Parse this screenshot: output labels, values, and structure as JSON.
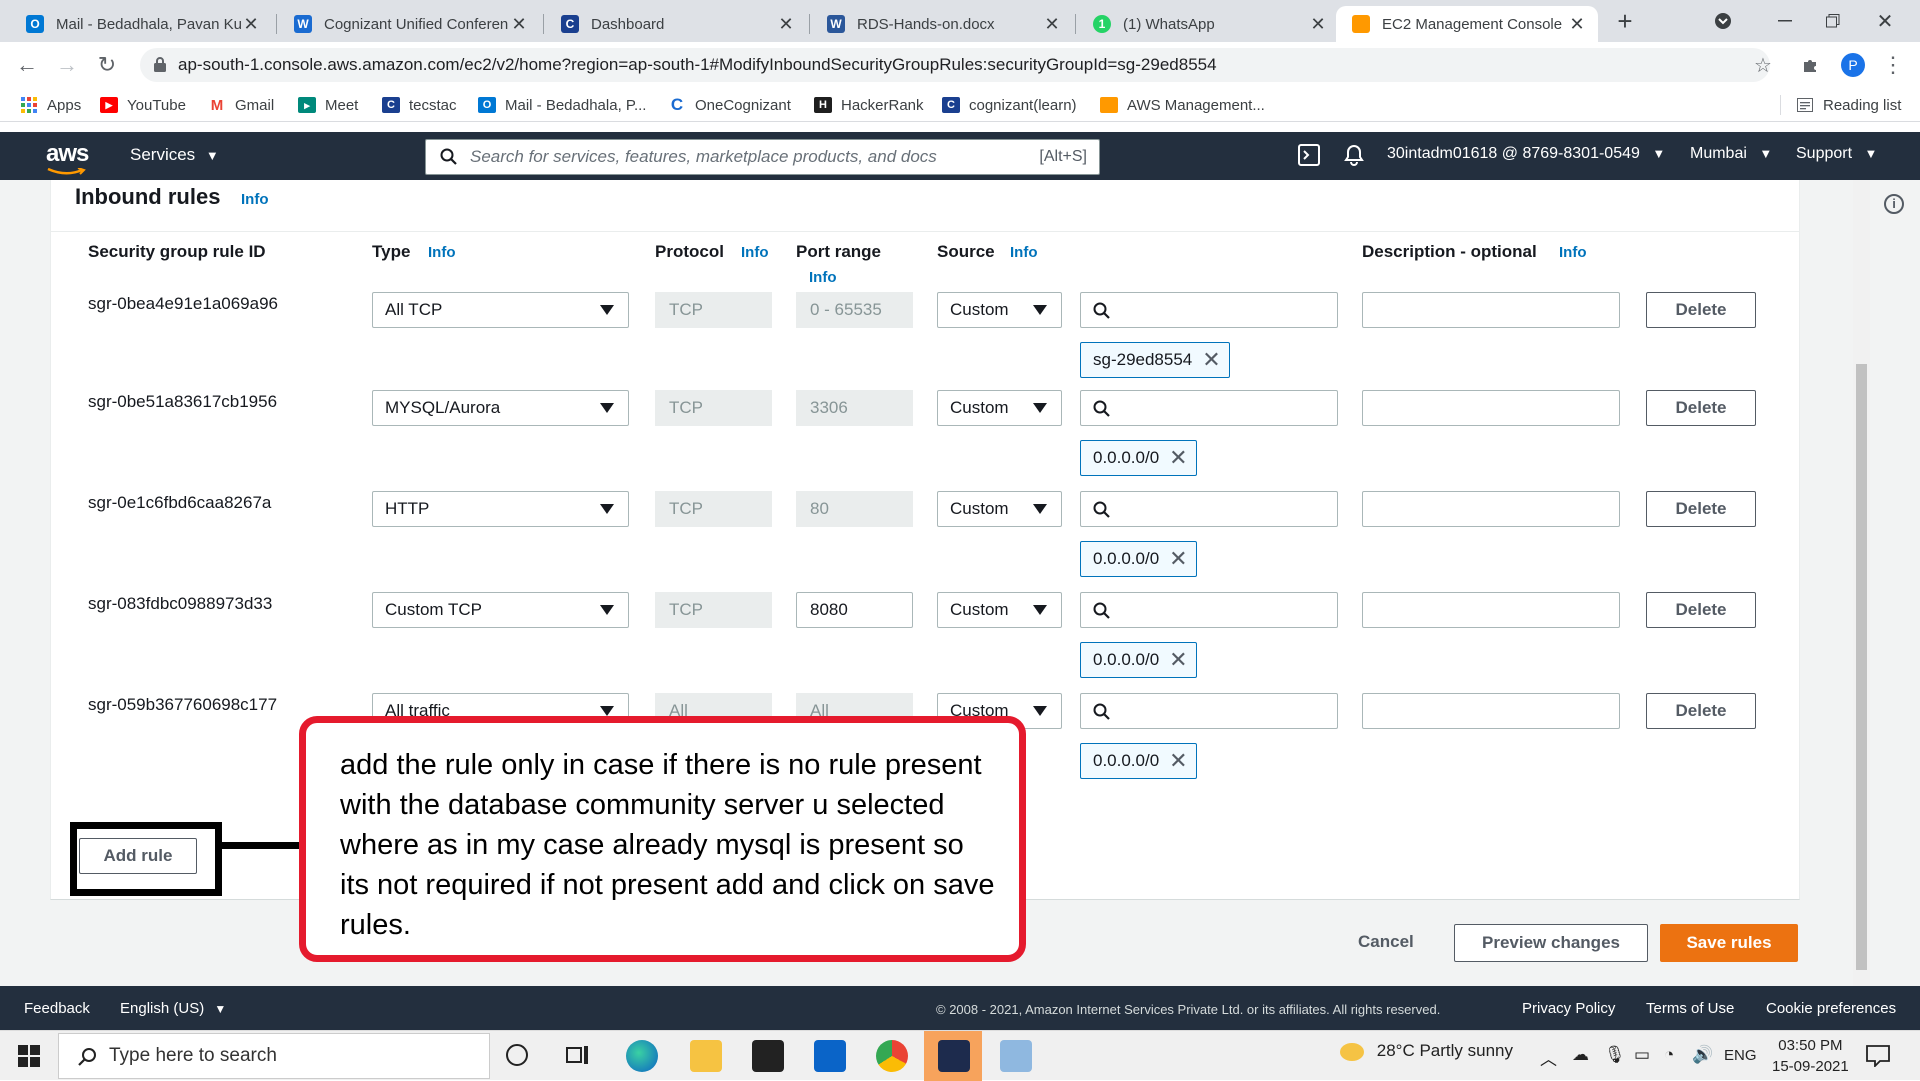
{
  "browser": {
    "tabs": [
      {
        "title": "Mail - Bedadhala, Pavan Ku",
        "color": "#0078d4",
        "glyph": "O"
      },
      {
        "title": "Cognizant Unified Conferen",
        "color": "#1a6bd1",
        "glyph": "W"
      },
      {
        "title": "Dashboard",
        "color": "#1a3f8f",
        "glyph": "C"
      },
      {
        "title": "RDS-Hands-on.docx",
        "color": "#2b579a",
        "glyph": "W"
      },
      {
        "title": "(1) WhatsApp",
        "color": "#25d366",
        "glyph": "1"
      },
      {
        "title": "EC2 Management Console",
        "color": "#ff9900",
        "glyph": ""
      }
    ],
    "new_tab": "+",
    "url": "ap-south-1.console.aws.amazon.com/ec2/v2/home?region=ap-south-1#ModifyInboundSecurityGroupRules:securityGroupId=sg-29ed8554",
    "profile_initial": "P",
    "bookmarks": [
      {
        "label": "Apps",
        "color": "#4285f4",
        "glyph": ""
      },
      {
        "label": "YouTube",
        "color": "#ff0000",
        "glyph": "▶"
      },
      {
        "label": "Gmail",
        "color": "#ea4335",
        "glyph": "M"
      },
      {
        "label": "Meet",
        "color": "#00897b",
        "glyph": "▸"
      },
      {
        "label": "tecstac",
        "color": "#1a3f8f",
        "glyph": "C"
      },
      {
        "label": "Mail - Bedadhala, P...",
        "color": "#0078d4",
        "glyph": "O"
      },
      {
        "label": "OneCognizant",
        "color": "#1a6bd1",
        "glyph": "C"
      },
      {
        "label": "HackerRank",
        "color": "#1f1f1f",
        "glyph": "H"
      },
      {
        "label": "cognizant(learn)",
        "color": "#1a3f8f",
        "glyph": "C"
      },
      {
        "label": "AWS Management...",
        "color": "#ff9900",
        "glyph": ""
      }
    ],
    "reading_list": "Reading list"
  },
  "aws": {
    "logo": "aws",
    "services": "Services",
    "search_placeholder": "Search for services, features, marketplace products, and docs",
    "search_hint": "[Alt+S]",
    "account": "30intadm01618 @ 8769-8301-0549",
    "region": "Mumbai",
    "support": "Support"
  },
  "panel": {
    "title": "Inbound rules",
    "info": "Info",
    "columns": {
      "rule_id": "Security group rule ID",
      "type": "Type",
      "protocol": "Protocol",
      "port_range": "Port range",
      "source": "Source",
      "description": "Description - optional"
    },
    "rules": [
      {
        "id": "sgr-0bea4e91e1a069a96",
        "type": "All TCP",
        "protocol": "TCP",
        "port": "0 - 65535",
        "port_editable": false,
        "source": "Custom",
        "token": "sg-29ed8554",
        "delete": "Delete"
      },
      {
        "id": "sgr-0be51a83617cb1956",
        "type": "MYSQL/Aurora",
        "protocol": "TCP",
        "port": "3306",
        "port_editable": false,
        "source": "Custom",
        "token": "0.0.0.0/0",
        "delete": "Delete"
      },
      {
        "id": "sgr-0e1c6fbd6caa8267a",
        "type": "HTTP",
        "protocol": "TCP",
        "port": "80",
        "port_editable": false,
        "source": "Custom",
        "token": "0.0.0.0/0",
        "delete": "Delete"
      },
      {
        "id": "sgr-083fdbc0988973d33",
        "type": "Custom TCP",
        "protocol": "TCP",
        "port": "8080",
        "port_editable": true,
        "source": "Custom",
        "token": "0.0.0.0/0",
        "delete": "Delete"
      },
      {
        "id": "sgr-059b367760698c177",
        "type": "All traffic",
        "protocol": "All",
        "port": "All",
        "port_editable": false,
        "source": "Custom",
        "token": "0.0.0.0/0",
        "delete": "Delete"
      }
    ],
    "add_rule": "Add rule"
  },
  "actions": {
    "cancel": "Cancel",
    "preview": "Preview changes",
    "save": "Save rules"
  },
  "annotation": "add the rule only in case if there is no rule present with the database community server u selected where as in my case already mysql is present so its not required if not present add and click on save rules.",
  "footer": {
    "feedback": "Feedback",
    "language": "English (US)",
    "copyright": "© 2008 - 2021, Amazon Internet Services Private Ltd. or its affiliates. All rights reserved.",
    "privacy": "Privacy Policy",
    "terms": "Terms of Use",
    "cookies": "Cookie preferences"
  },
  "taskbar": {
    "search_placeholder": "Type here to search",
    "weather": "28°C  Partly sunny",
    "lang": "ENG",
    "time": "03:50 PM",
    "date": "15-09-2021"
  },
  "colors": {
    "aws_nav": "#232f3e",
    "save_orange": "#ec7211",
    "info_blue": "#0073bb",
    "annotation_red": "#e51a2d"
  }
}
